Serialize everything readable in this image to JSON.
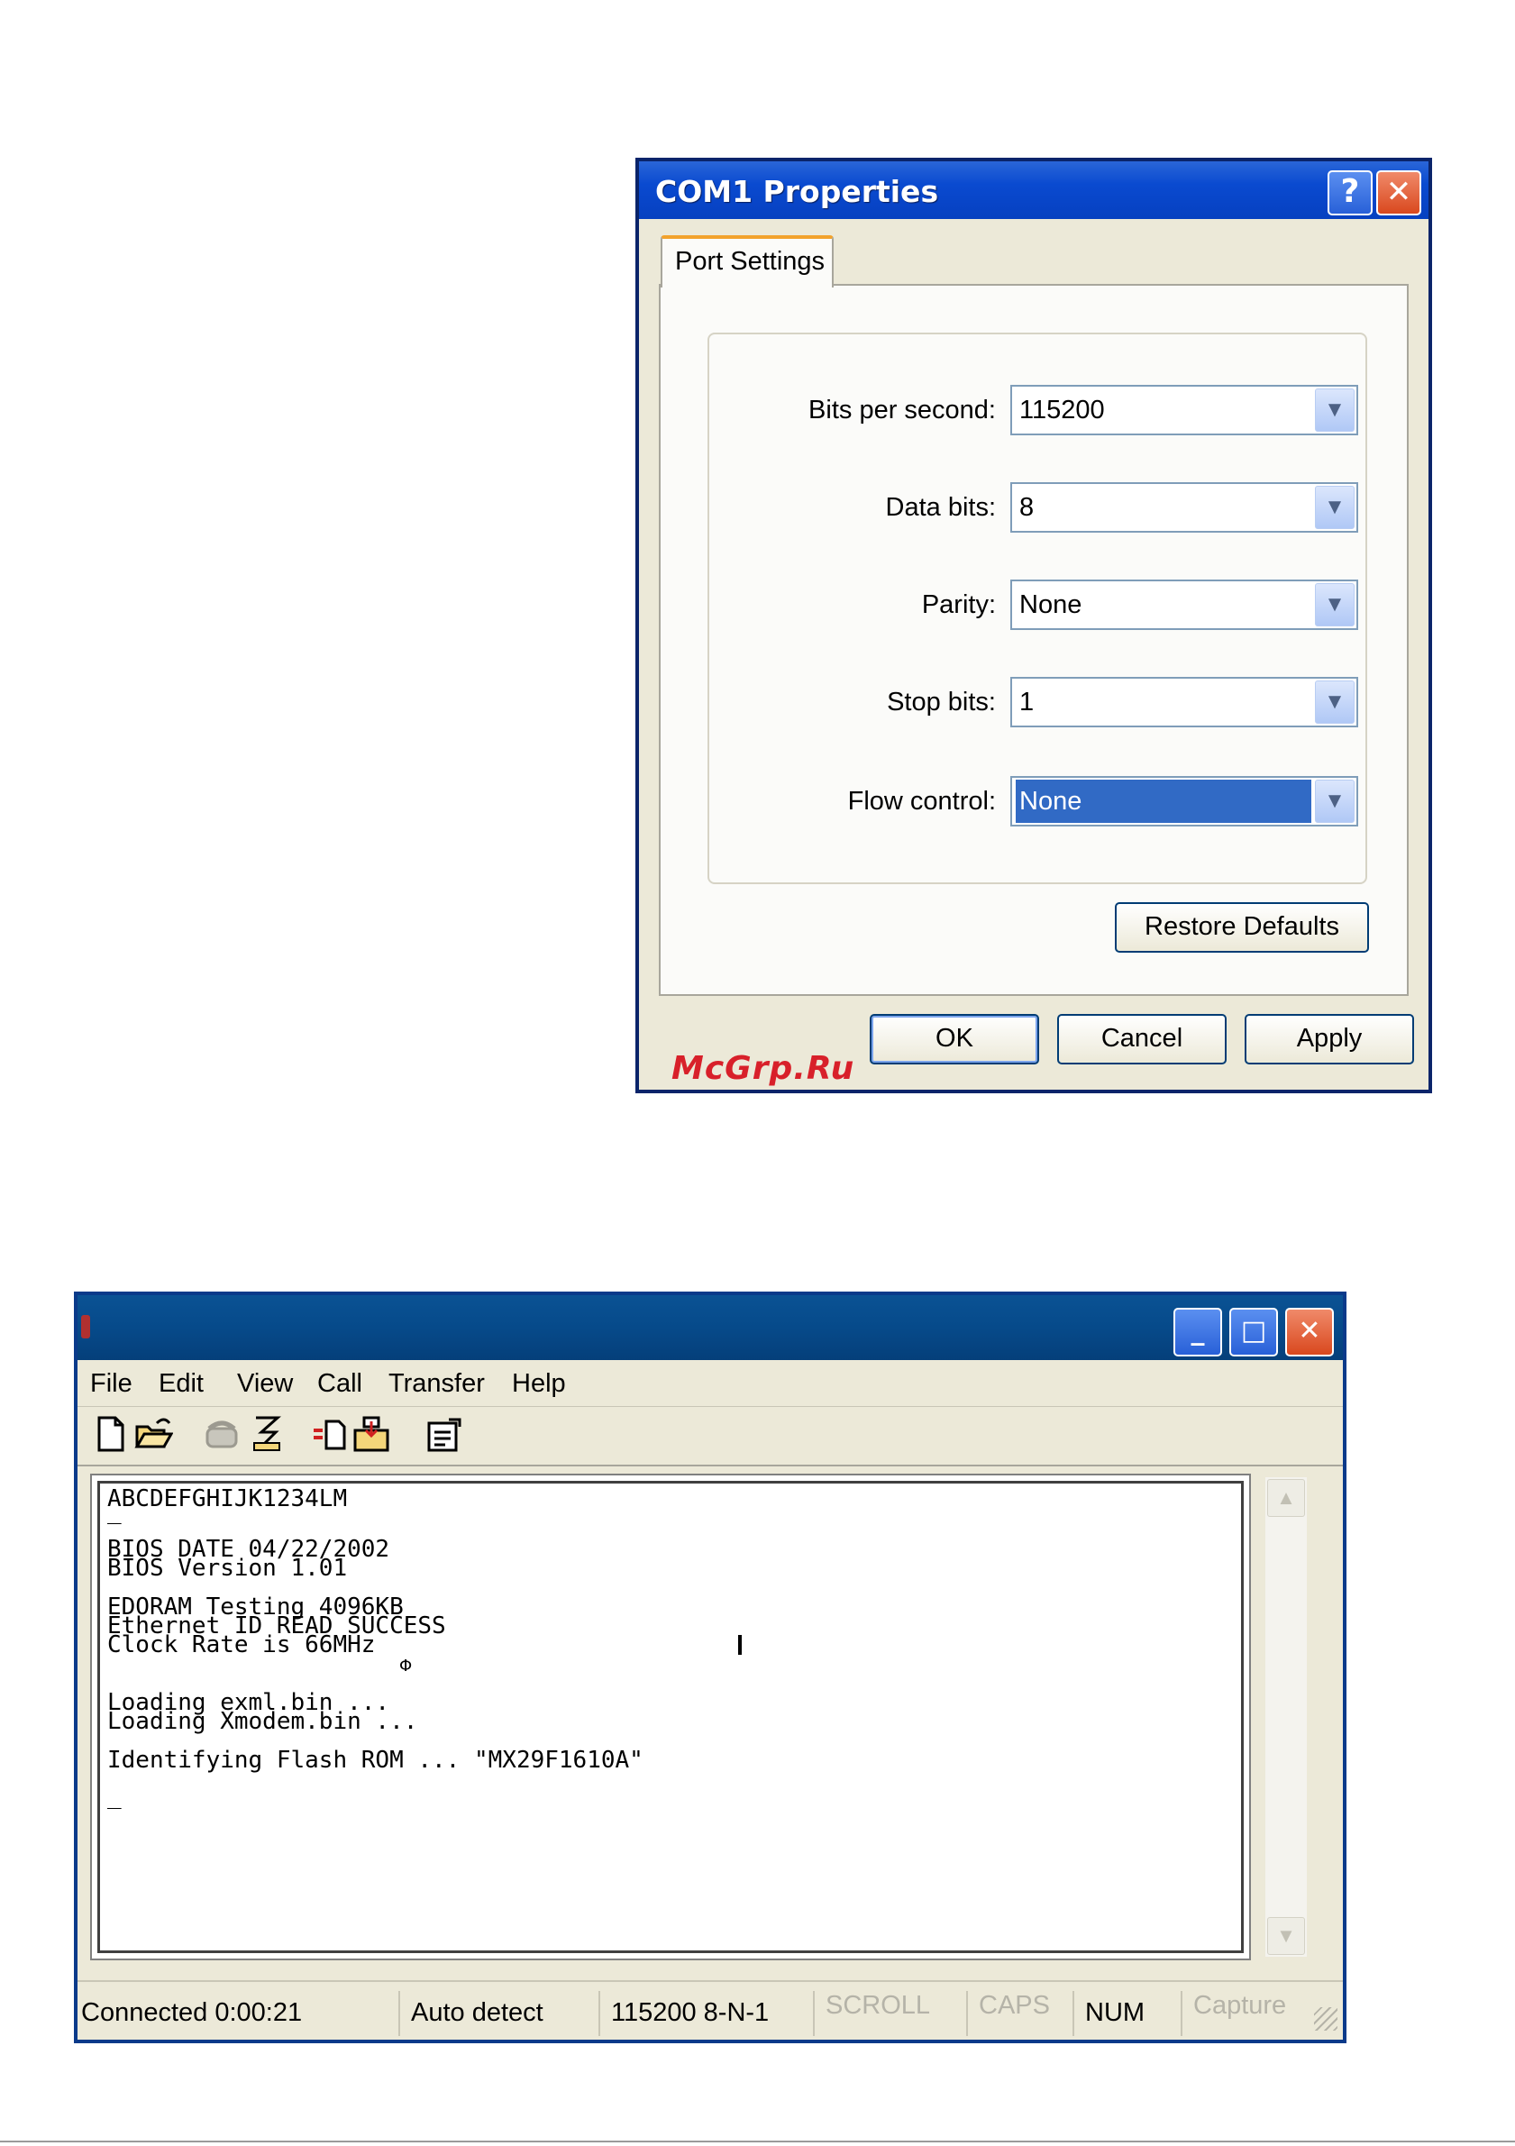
{
  "dialog": {
    "title": "COM1 Properties",
    "help_glyph": "?",
    "close_glyph": "✕",
    "tab_label": "Port Settings",
    "fields": [
      {
        "label": "Bits per second:",
        "value": "115200"
      },
      {
        "label": "Data bits:",
        "value": "8"
      },
      {
        "label": "Parity:",
        "value": "None"
      },
      {
        "label": "Stop bits:",
        "value": "1"
      },
      {
        "label": "Flow control:",
        "value": "None",
        "selected": true
      }
    ],
    "restore_label": "Restore Defaults",
    "ok_label": "OK",
    "cancel_label": "Cancel",
    "apply_label": "Apply"
  },
  "watermark": "McGrp.Ru",
  "terminal": {
    "caption_buttons": {
      "minimize": "_",
      "maximize": "□",
      "close": "✕"
    },
    "menu": [
      "File",
      "Edit",
      "View",
      "Call",
      "Transfer",
      "Help"
    ],
    "toolbar_icons": [
      "new-icon",
      "open-icon",
      "phone-icon",
      "disconnect-icon",
      "send-icon",
      "receive-icon",
      "properties-icon"
    ],
    "lines": [
      "ABCDEFGHIJK1234LM",
      "_",
      "",
      "BIOS DATE 04/22/2002",
      "BIOS Version 1.01",
      "",
      "EDORAM Testing 4096KB",
      "Ethernet ID READ SUCCESS",
      "Clock Rate is 66MHz",
      "",
      "",
      "Loading exml.bin ...",
      "Loading Xmodem.bin ...",
      "",
      "Identifying Flash ROM ... \"MX29F1610A\"",
      "",
      "_"
    ],
    "status": {
      "connected": "Connected 0:00:21",
      "detect": "Auto detect",
      "settings": "115200 8-N-1",
      "scroll": "SCROLL",
      "caps": "CAPS",
      "num": "NUM",
      "capture": "Capture"
    }
  }
}
